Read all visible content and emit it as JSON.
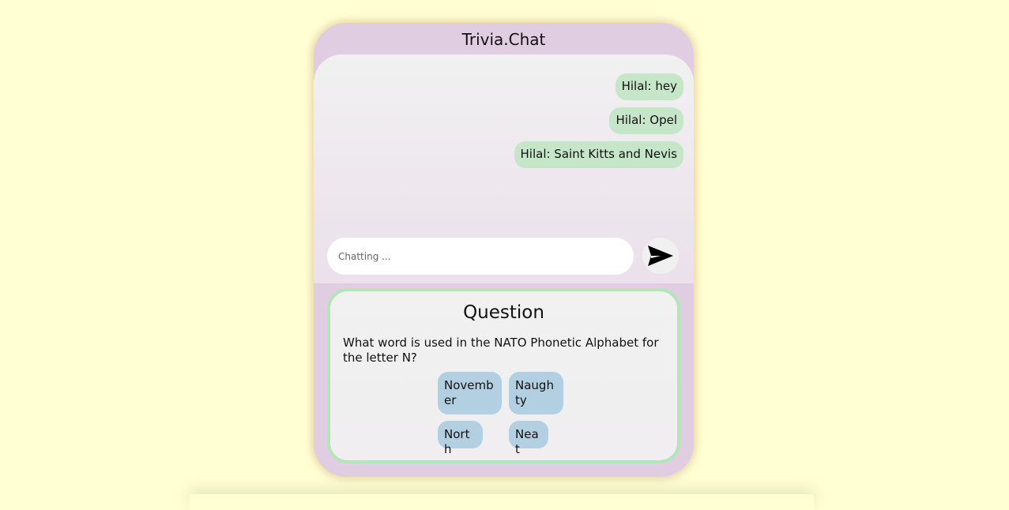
{
  "app": {
    "title": "Trivia.Chat"
  },
  "chat": {
    "messages": [
      "Hilal: hey",
      "Hilal: Opel",
      "Hilal: Saint Kitts and Nevis"
    ],
    "input": {
      "placeholder": "Chatting ...",
      "value": ""
    },
    "send_icon": "send-arrow-icon"
  },
  "question": {
    "heading": "Question",
    "text": "What word is used in the NATO Phonetic Alphabet for the letter N?",
    "answers": [
      "November",
      "Naughty",
      "North",
      "Neat"
    ]
  },
  "colors": {
    "background": "#ffffd3",
    "phone": "#e1cde2",
    "message_bubble": "#c6e6c9",
    "answer_button": "#b3cfe2",
    "card_border": "#b2e6b9"
  }
}
